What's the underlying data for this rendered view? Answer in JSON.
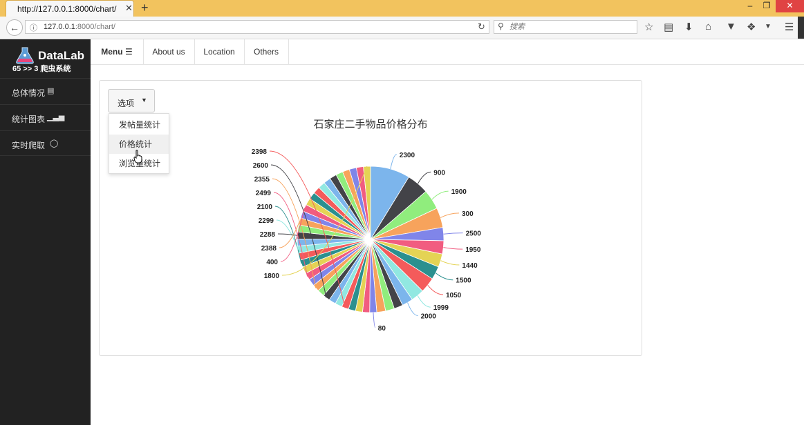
{
  "browser": {
    "tab_title": "http://127.0.0.1:8000/chart/",
    "tab_close": "✕",
    "new_tab": "+",
    "url_host": "127.0.0.1",
    "url_rest": ":8000/chart/",
    "search_placeholder": "搜索",
    "window_buttons": [
      "–",
      "❐",
      "✕"
    ],
    "toolbar_icons": [
      "star-icon",
      "reader-icon",
      "download-icon",
      "home-icon",
      "pocket-icon",
      "extension-icon",
      "hamburger-icon"
    ]
  },
  "sidebar": {
    "logo_text": "DataLab",
    "logo_subtitle": "65 >> 3 爬虫系统",
    "items": [
      {
        "label": "总体情况",
        "icon": "list-icon"
      },
      {
        "label": "统计图表",
        "icon": "bar-chart-icon"
      },
      {
        "label": "实时爬取",
        "icon": "lightbulb-icon"
      }
    ]
  },
  "topnav": {
    "menu_label": "Menu",
    "items": [
      "About us",
      "Location",
      "Others"
    ]
  },
  "dropdown": {
    "button_label": "选项",
    "items": [
      "发帖量统计",
      "价格统计",
      "浏览量统计"
    ],
    "hovered_index": 1
  },
  "colors": {
    "sidebar_bg": "#222222",
    "tabbar": "#f2c35e",
    "close_red": "#e04343"
  },
  "chart_data": {
    "type": "pie",
    "title": "石家庄二手物品价格分布",
    "labeled_slices": [
      "2300",
      "900",
      "1900",
      "300",
      "2500",
      "1950",
      "1440",
      "1500",
      "1050",
      "1999",
      "2000",
      "80",
      "2398",
      "2600",
      "2355",
      "2499",
      "2100",
      "2299",
      "2288",
      "2388",
      "400",
      "1800"
    ],
    "slices": [
      {
        "label": "2300",
        "value": 9.0,
        "color": "#7cb5ec"
      },
      {
        "label": "900",
        "value": 5.0,
        "color": "#434348"
      },
      {
        "label": "1900",
        "value": 4.5,
        "color": "#90ed7d"
      },
      {
        "label": "300",
        "value": 4.5,
        "color": "#f7a35c"
      },
      {
        "label": "2500",
        "value": 3.0,
        "color": "#8085e9"
      },
      {
        "label": "1950",
        "value": 3.0,
        "color": "#f15c80"
      },
      {
        "label": "1440",
        "value": 3.0,
        "color": "#e4d354"
      },
      {
        "label": "1500",
        "value": 3.0,
        "color": "#2b908f"
      },
      {
        "label": "1050",
        "value": 3.5,
        "color": "#f45b5b"
      },
      {
        "label": "1999",
        "value": 3.0,
        "color": "#91e8e1"
      },
      {
        "label": "2000",
        "value": 2.5,
        "color": "#7cb5ec"
      },
      {
        "label": "",
        "value": 2.0,
        "color": "#434348"
      },
      {
        "label": "",
        "value": 2.0,
        "color": "#90ed7d"
      },
      {
        "label": "",
        "value": 2.0,
        "color": "#f7a35c"
      },
      {
        "label": "80",
        "value": 1.6,
        "color": "#8085e9"
      },
      {
        "label": "",
        "value": 1.6,
        "color": "#f15c80"
      },
      {
        "label": "",
        "value": 1.6,
        "color": "#e4d354"
      },
      {
        "label": "",
        "value": 1.6,
        "color": "#2b908f"
      },
      {
        "label": "2398",
        "value": 1.6,
        "color": "#f45b5b"
      },
      {
        "label": "",
        "value": 1.6,
        "color": "#91e8e1"
      },
      {
        "label": "",
        "value": 1.6,
        "color": "#7cb5ec"
      },
      {
        "label": "2600",
        "value": 1.6,
        "color": "#434348"
      },
      {
        "label": "",
        "value": 1.6,
        "color": "#90ed7d"
      },
      {
        "label": "2355",
        "value": 1.6,
        "color": "#f7a35c"
      },
      {
        "label": "",
        "value": 1.6,
        "color": "#8085e9"
      },
      {
        "label": "2499",
        "value": 1.6,
        "color": "#f15c80"
      },
      {
        "label": "",
        "value": 1.6,
        "color": "#e4d354"
      },
      {
        "label": "2100",
        "value": 1.6,
        "color": "#2b908f"
      },
      {
        "label": "",
        "value": 1.6,
        "color": "#f45b5b"
      },
      {
        "label": "2299",
        "value": 1.6,
        "color": "#91e8e1"
      },
      {
        "label": "",
        "value": 1.6,
        "color": "#7cb5ec"
      },
      {
        "label": "2288",
        "value": 1.6,
        "color": "#434348"
      },
      {
        "label": "",
        "value": 1.6,
        "color": "#90ed7d"
      },
      {
        "label": "2388",
        "value": 1.6,
        "color": "#f7a35c"
      },
      {
        "label": "",
        "value": 1.6,
        "color": "#8085e9"
      },
      {
        "label": "400",
        "value": 1.6,
        "color": "#f15c80"
      },
      {
        "label": "",
        "value": 1.6,
        "color": "#e4d354"
      },
      {
        "label": "",
        "value": 1.6,
        "color": "#2b908f"
      },
      {
        "label": "",
        "value": 1.6,
        "color": "#f45b5b"
      },
      {
        "label": "",
        "value": 1.6,
        "color": "#91e8e1"
      },
      {
        "label": "",
        "value": 1.6,
        "color": "#7cb5ec"
      },
      {
        "label": "",
        "value": 1.6,
        "color": "#434348"
      },
      {
        "label": "",
        "value": 1.6,
        "color": "#90ed7d"
      },
      {
        "label": "",
        "value": 1.6,
        "color": "#f7a35c"
      },
      {
        "label": "",
        "value": 1.6,
        "color": "#8085e9"
      },
      {
        "label": "",
        "value": 1.6,
        "color": "#f15c80"
      },
      {
        "label": "1800",
        "value": 1.6,
        "color": "#e4d354"
      }
    ],
    "legend": "none"
  }
}
